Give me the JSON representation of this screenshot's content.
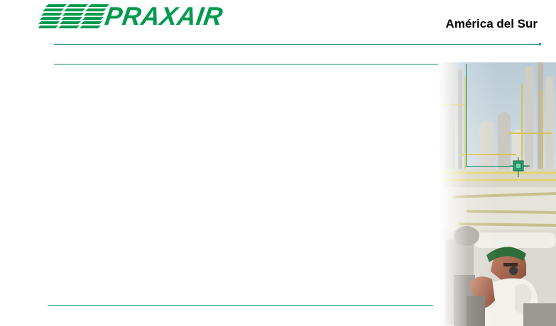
{
  "brand": {
    "name": "PRAXAIR",
    "region": "América del Sur",
    "logo_color": "#009a4e"
  },
  "colors": {
    "accent_line": "#0b8a5c",
    "bottom_line": "#1e8a5e",
    "background": "#ffffff",
    "region_text": "#000000"
  },
  "decor": {
    "photo_icon": "industrial-plant-worker-photo",
    "target_icon": "crosshair-target-icon"
  }
}
